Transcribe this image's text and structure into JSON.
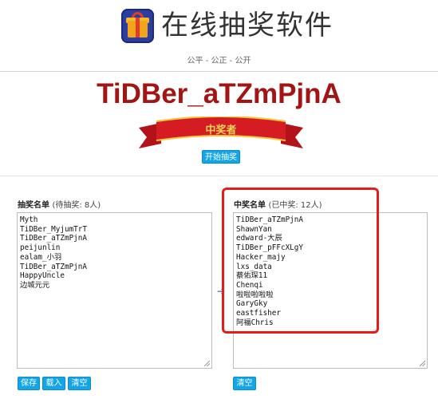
{
  "app": {
    "title": "在线抽奖软件",
    "slogan": "公平 - 公正 - 公开"
  },
  "draw": {
    "winner_name": "TiDBer_aTZmPjnA",
    "banner_label": "中奖者",
    "start_button": "开始抽奖"
  },
  "candidates": {
    "title": "抽奖名单",
    "subtitle": "(待抽奖: 8人)",
    "names": [
      "Myth",
      "TiDBer_MyjumTrT",
      "TiDBer_aTZmPjnA",
      "peijunlin",
      "ealam_小羽",
      "TiDBer_aTZmPjnA",
      "HappyUncle",
      "边城元元"
    ]
  },
  "winners": {
    "title": "中奖名单",
    "subtitle": "(已中奖: 12人)",
    "names": [
      "TiDBer_aTZmPjnA",
      "ShawnYan",
      "edward-大辰",
      "TiDBer_pFFcXLgY",
      "Hacker_majy",
      "lxs_data",
      "蔡佑琛11",
      "Chenqi",
      "啦啦啦啦啦",
      "GaryGky",
      "eastfisher",
      "阿福Chris"
    ]
  },
  "buttons": {
    "save": "保存",
    "load": "载入",
    "clear_left": "清空",
    "clear_right": "清空"
  },
  "colors": {
    "winner_text": "#a31414",
    "button": "#12a5e8",
    "highlight_box": "#e51c1c"
  },
  "icons": {
    "logo": "gift-box-icon",
    "arrow": "arrow-right-icon"
  }
}
